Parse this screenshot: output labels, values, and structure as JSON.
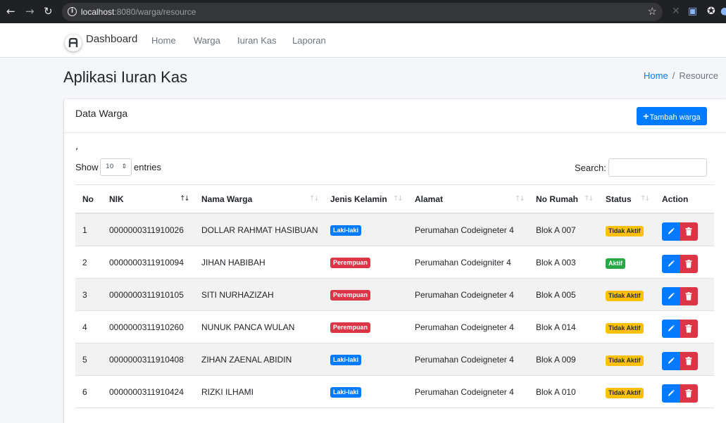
{
  "browser": {
    "url_host": "localhost",
    "url_rest": ":8080/warga/resource"
  },
  "navbar": {
    "brand": "Dashboard",
    "links": [
      "Home",
      "Warga",
      "Iuran Kas",
      "Laporan"
    ]
  },
  "header": {
    "title": "Aplikasi Iuran Kas",
    "breadcrumb": {
      "home": "Home",
      "sep": "/",
      "current": "Resource"
    }
  },
  "card": {
    "title": "Data Warga",
    "add_button": "Tambah warga",
    "stray_text": ",",
    "show_label": "Show",
    "page_length": "10",
    "entries_label": "entries",
    "search_label": "Search:"
  },
  "table": {
    "headers": [
      "No",
      "NIK",
      "Nama Warga",
      "Jenis Kelamin",
      "Alamat",
      "No Rumah",
      "Status",
      "Action"
    ],
    "rows": [
      {
        "no": "1",
        "nik": "0000000311910026",
        "nama": "DOLLAR RAHMAT HASIBUAN",
        "jk": "Laki-laki",
        "alamat": "Perumahan Codeigneter 4",
        "rumah": "Blok A 007",
        "status": "Tidak Aktif"
      },
      {
        "no": "2",
        "nik": "0000000311910094",
        "nama": "JIHAN HABIBAH",
        "jk": "Perempuan",
        "alamat": "Perumahan Codeigniter 4",
        "rumah": "Blok A 003",
        "status": "Aktif"
      },
      {
        "no": "3",
        "nik": "0000000311910105",
        "nama": "SITI NURHAZIZAH",
        "jk": "Perempuan",
        "alamat": "Perumahan Codeigneter 4",
        "rumah": "Blok A 005",
        "status": "Tidak Aktif"
      },
      {
        "no": "4",
        "nik": "0000000311910260",
        "nama": "NUNUK PANCA WULAN",
        "jk": "Perempuan",
        "alamat": "Perumahan Codeigneter 4",
        "rumah": "Blok A 014",
        "status": "Tidak Aktif"
      },
      {
        "no": "5",
        "nik": "0000000311910408",
        "nama": "ZIHAN ZAENAL ABIDIN",
        "jk": "Laki-laki",
        "alamat": "Perumahan Codeigneter 4",
        "rumah": "Blok A 009",
        "status": "Tidak Aktif"
      },
      {
        "no": "6",
        "nik": "0000000311910424",
        "nama": "RIZKI ILHAMI",
        "jk": "Laki-laki",
        "alamat": "Perumahan Codeigneter 4",
        "rumah": "Blok A 010",
        "status": "Tidak Aktif"
      }
    ]
  },
  "colors": {
    "primary": "#007bff",
    "danger": "#dc3545",
    "warning": "#ffc107",
    "success": "#28a745"
  }
}
